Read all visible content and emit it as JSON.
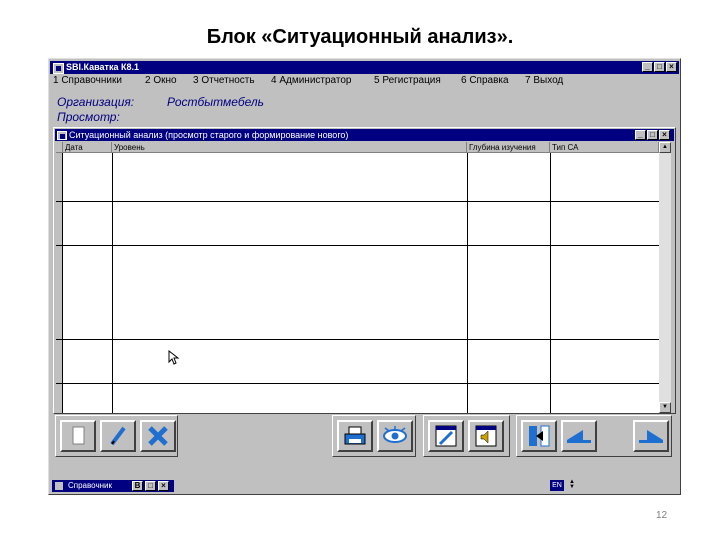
{
  "slide": {
    "title": "Блок «Ситуационный анализ».",
    "page_number": "12"
  },
  "window": {
    "title": "SBI.Каватка К8.1",
    "minimize": "_",
    "maximize": "□",
    "close": "×"
  },
  "menu": [
    {
      "label": "1 Справочники"
    },
    {
      "label": "2 Окно"
    },
    {
      "label": "3 Отчетность"
    },
    {
      "label": "4 Администратор"
    },
    {
      "label": "5 Регистрация"
    },
    {
      "label": "6 Справка"
    },
    {
      "label": "7 Выход"
    }
  ],
  "header": {
    "org_label": "Организация:",
    "org_value": "Ростбытмебель",
    "view_label": "Просмотр:"
  },
  "child_window": {
    "title": "Ситуационный анализ (просмотр старого и формирование нового)",
    "minimize": "_",
    "maximize": "□",
    "close": "×"
  },
  "table": {
    "columns": [
      "Дата",
      "Уровень",
      "Глубина изучения",
      "Тип СА"
    ]
  },
  "taskbar": {
    "task_label": "Справочник",
    "lang": "EN",
    "restore": "B",
    "maximize": "□",
    "close": "×"
  },
  "colors": {
    "titlebar": "#000080",
    "face": "#c0c0c0",
    "accent_blue": "#1f6fd0"
  }
}
